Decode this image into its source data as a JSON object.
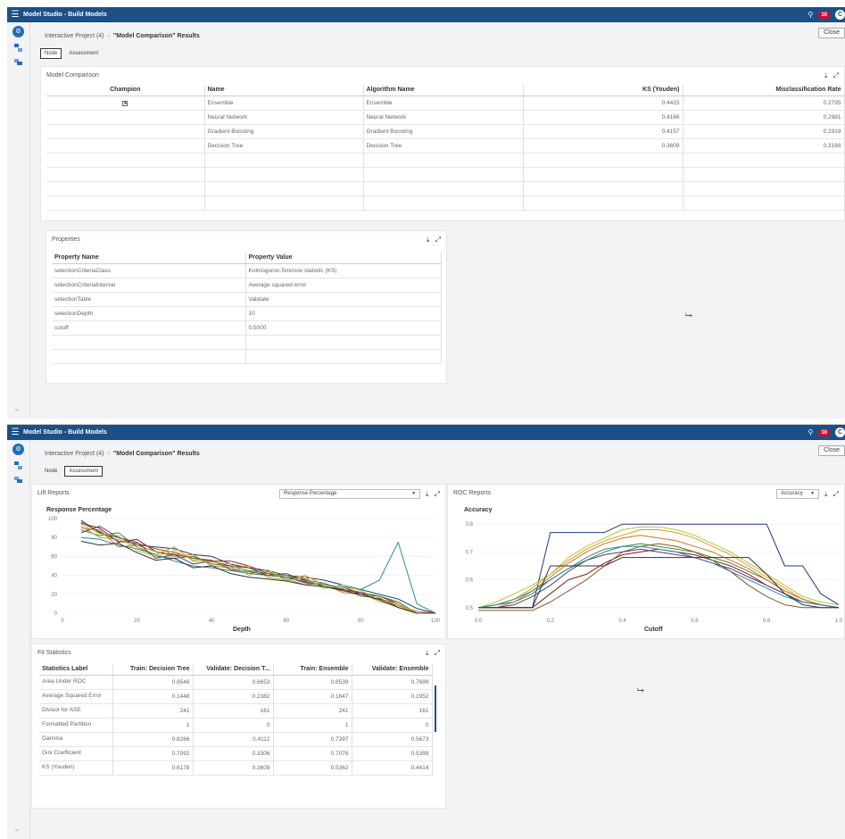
{
  "app": {
    "title": "Model Studio - Build Models",
    "notifications": "10",
    "avatar": "C",
    "rail_expand": "»"
  },
  "breadcrumb": {
    "project": "Interactive Project (4)",
    "separator": "›",
    "current": "\"Model Comparison\" Results"
  },
  "close_label": "Close",
  "tabs": [
    "Node",
    "Assessment"
  ],
  "model_comparison": {
    "title": "Model Comparison",
    "columns": [
      "Champion",
      "Name",
      "Algorithm Name",
      "KS (Youden)",
      "Misclassification Rate"
    ],
    "rows": [
      {
        "champion": "★",
        "name": "Ensemble",
        "algorithm": "Ensemble",
        "ks": "0.4415",
        "misc": "0.2795"
      },
      {
        "champion": "",
        "name": "Neural Network",
        "algorithm": "Neural Network",
        "ks": "0.4166",
        "misc": "0.2981"
      },
      {
        "champion": "",
        "name": "Gradient Boosting",
        "algorithm": "Gradient Boosting",
        "ks": "0.4157",
        "misc": "0.2919"
      },
      {
        "champion": "",
        "name": "Decision Tree",
        "algorithm": "Decision Tree",
        "ks": "0.3609",
        "misc": "0.3168"
      }
    ]
  },
  "properties": {
    "title": "Properties",
    "columns": [
      "Property Name",
      "Property Value"
    ],
    "rows": [
      {
        "name": "selectionCriteriaClass",
        "value": "Kolmogorov-Smirnov statistic (KS)"
      },
      {
        "name": "selectionCriteriaInterval",
        "value": "Average squared error"
      },
      {
        "name": "selectionTable",
        "value": "Validate"
      },
      {
        "name": "selectionDepth",
        "value": "10"
      },
      {
        "name": "cutoff",
        "value": "0.5000"
      }
    ]
  },
  "lift": {
    "title": "Lift Reports",
    "select": "Response Percentage"
  },
  "roc": {
    "title": "ROC Reports",
    "select": "Accuracy"
  },
  "fit": {
    "title": "Fit Statistics",
    "columns": [
      "Statistics Label",
      "Train: Decision Tree",
      "Validate: Decision T...",
      "Train: Ensemble",
      "Validate: Ensemble"
    ],
    "rows": [
      [
        "Area Under ROC",
        "0.8546",
        "0.6653",
        "0.8539",
        "0.7699"
      ],
      [
        "Average Squared Error",
        "0.1448",
        "0.2382",
        "0.1647",
        "0.1952"
      ],
      [
        "Divisor for ASE",
        "241",
        "161",
        "241",
        "161"
      ],
      [
        "Formatted Partition",
        "1",
        "0",
        "1",
        "0"
      ],
      [
        "Gamma",
        "0.8266",
        "0.4112",
        "0.7397",
        "0.5673"
      ],
      [
        "Gini Coefficient",
        "0.7092",
        "0.3306",
        "0.7078",
        "0.5399"
      ],
      [
        "KS (Youden)",
        "0.6178",
        "0.3609",
        "0.5362",
        "0.4414"
      ]
    ]
  },
  "colors": {
    "header": "#1c4f86",
    "badge": "#c8102e",
    "series": [
      "#1f3a7a",
      "#8b1a1a",
      "#3b8a3a",
      "#d4a017",
      "#c8742a",
      "#5a3a7a",
      "#2a8a9a",
      "#7a5a2a",
      "#b8c040",
      "#333333"
    ]
  },
  "chart_data": [
    {
      "type": "line",
      "title": "Response Percentage",
      "xlabel": "Depth",
      "ylabel": "Response Percentage",
      "xlim": [
        0,
        100
      ],
      "ylim": [
        0,
        100
      ],
      "xticks": [
        0,
        20,
        40,
        60,
        80,
        100
      ],
      "yticks": [
        0,
        20,
        40,
        60,
        80,
        100
      ],
      "x": [
        5,
        10,
        15,
        20,
        25,
        30,
        35,
        40,
        45,
        50,
        55,
        60,
        65,
        70,
        75,
        80,
        85,
        90,
        95,
        100
      ],
      "series": [
        {
          "values": [
            98,
            85,
            80,
            72,
            70,
            68,
            62,
            60,
            52,
            48,
            45,
            40,
            38,
            35,
            30,
            25,
            20,
            15,
            5,
            0
          ]
        },
        {
          "values": [
            95,
            90,
            75,
            78,
            65,
            62,
            58,
            55,
            55,
            50,
            42,
            38,
            33,
            30,
            28,
            20,
            18,
            10,
            0,
            0
          ]
        },
        {
          "values": [
            88,
            82,
            85,
            70,
            60,
            58,
            60,
            52,
            50,
            45,
            42,
            40,
            35,
            32,
            25,
            22,
            18,
            12,
            0,
            0
          ]
        },
        {
          "values": [
            92,
            80,
            78,
            70,
            62,
            70,
            55,
            55,
            48,
            50,
            38,
            35,
            40,
            30,
            28,
            22,
            12,
            8,
            0,
            0
          ]
        },
        {
          "values": [
            90,
            88,
            70,
            72,
            65,
            60,
            62,
            50,
            48,
            42,
            44,
            36,
            30,
            32,
            22,
            20,
            15,
            8,
            2,
            0
          ]
        },
        {
          "values": [
            85,
            92,
            80,
            75,
            58,
            62,
            52,
            55,
            50,
            48,
            40,
            38,
            36,
            28,
            25,
            22,
            15,
            10,
            0,
            0
          ]
        },
        {
          "values": [
            80,
            78,
            72,
            68,
            62,
            55,
            50,
            48,
            45,
            42,
            40,
            38,
            32,
            30,
            28,
            25,
            35,
            75,
            10,
            0
          ]
        },
        {
          "values": [
            96,
            86,
            76,
            74,
            68,
            64,
            58,
            56,
            46,
            44,
            40,
            42,
            34,
            28,
            26,
            18,
            16,
            6,
            0,
            0
          ]
        },
        {
          "values": [
            94,
            84,
            82,
            66,
            60,
            66,
            56,
            54,
            52,
            40,
            46,
            34,
            38,
            26,
            30,
            24,
            14,
            10,
            0,
            0
          ]
        },
        {
          "values": [
            76,
            72,
            74,
            64,
            56,
            58,
            48,
            50,
            42,
            38,
            36,
            34,
            30,
            28,
            24,
            20,
            14,
            6,
            0,
            0
          ]
        }
      ]
    },
    {
      "type": "line",
      "title": "Accuracy",
      "xlabel": "Cutoff",
      "ylabel": "Accuracy",
      "xlim": [
        0,
        1
      ],
      "ylim": [
        0.48,
        0.82
      ],
      "xticks": [
        0,
        0.2,
        0.4,
        0.6,
        0.8,
        1.0
      ],
      "xtick_labels": [
        "0.0",
        "0.2",
        "0.4",
        "0.6",
        "0.8",
        "1.0"
      ],
      "yticks": [
        0.5,
        0.6,
        0.7,
        0.8
      ],
      "x": [
        0,
        0.05,
        0.1,
        0.15,
        0.2,
        0.25,
        0.3,
        0.35,
        0.4,
        0.45,
        0.5,
        0.55,
        0.6,
        0.65,
        0.7,
        0.75,
        0.8,
        0.85,
        0.9,
        0.95,
        1.0
      ],
      "series": [
        {
          "values": [
            0.5,
            0.5,
            0.5,
            0.5,
            0.77,
            0.77,
            0.77,
            0.77,
            0.8,
            0.8,
            0.8,
            0.8,
            0.8,
            0.8,
            0.8,
            0.8,
            0.8,
            0.65,
            0.65,
            0.55,
            0.51
          ]
        },
        {
          "values": [
            0.5,
            0.5,
            0.5,
            0.5,
            0.55,
            0.6,
            0.62,
            0.66,
            0.69,
            0.7,
            0.71,
            0.7,
            0.69,
            0.67,
            0.65,
            0.62,
            0.58,
            0.55,
            0.52,
            0.51,
            0.5
          ]
        },
        {
          "values": [
            0.5,
            0.51,
            0.52,
            0.55,
            0.6,
            0.64,
            0.67,
            0.7,
            0.72,
            0.73,
            0.72,
            0.71,
            0.7,
            0.68,
            0.66,
            0.63,
            0.6,
            0.56,
            0.53,
            0.51,
            0.5
          ]
        },
        {
          "values": [
            0.5,
            0.51,
            0.53,
            0.57,
            0.62,
            0.67,
            0.71,
            0.74,
            0.76,
            0.78,
            0.78,
            0.77,
            0.75,
            0.72,
            0.69,
            0.65,
            0.61,
            0.57,
            0.53,
            0.51,
            0.5
          ]
        },
        {
          "values": [
            0.5,
            0.5,
            0.52,
            0.56,
            0.61,
            0.66,
            0.7,
            0.73,
            0.75,
            0.76,
            0.75,
            0.74,
            0.72,
            0.7,
            0.67,
            0.64,
            0.6,
            0.56,
            0.53,
            0.51,
            0.5
          ]
        },
        {
          "values": [
            0.5,
            0.5,
            0.51,
            0.54,
            0.58,
            0.63,
            0.67,
            0.69,
            0.7,
            0.71,
            0.7,
            0.69,
            0.68,
            0.66,
            0.64,
            0.61,
            0.58,
            0.55,
            0.52,
            0.51,
            0.5
          ]
        },
        {
          "values": [
            0.5,
            0.51,
            0.53,
            0.56,
            0.6,
            0.64,
            0.68,
            0.71,
            0.72,
            0.72,
            0.71,
            0.7,
            0.68,
            0.66,
            0.63,
            0.6,
            0.57,
            0.54,
            0.52,
            0.51,
            0.5
          ]
        },
        {
          "values": [
            0.49,
            0.49,
            0.49,
            0.49,
            0.52,
            0.56,
            0.6,
            0.65,
            0.7,
            0.72,
            0.73,
            0.72,
            0.7,
            0.67,
            0.63,
            0.58,
            0.54,
            0.51,
            0.5,
            0.5,
            0.5
          ]
        },
        {
          "values": [
            0.5,
            0.52,
            0.55,
            0.58,
            0.62,
            0.68,
            0.72,
            0.75,
            0.78,
            0.79,
            0.79,
            0.78,
            0.76,
            0.73,
            0.7,
            0.66,
            0.62,
            0.58,
            0.54,
            0.52,
            0.51
          ]
        },
        {
          "values": [
            0.5,
            0.5,
            0.5,
            0.5,
            0.65,
            0.65,
            0.65,
            0.65,
            0.68,
            0.68,
            0.68,
            0.68,
            0.68,
            0.68,
            0.68,
            0.68,
            0.62,
            0.55,
            0.51,
            0.5,
            0.5
          ]
        }
      ]
    }
  ]
}
